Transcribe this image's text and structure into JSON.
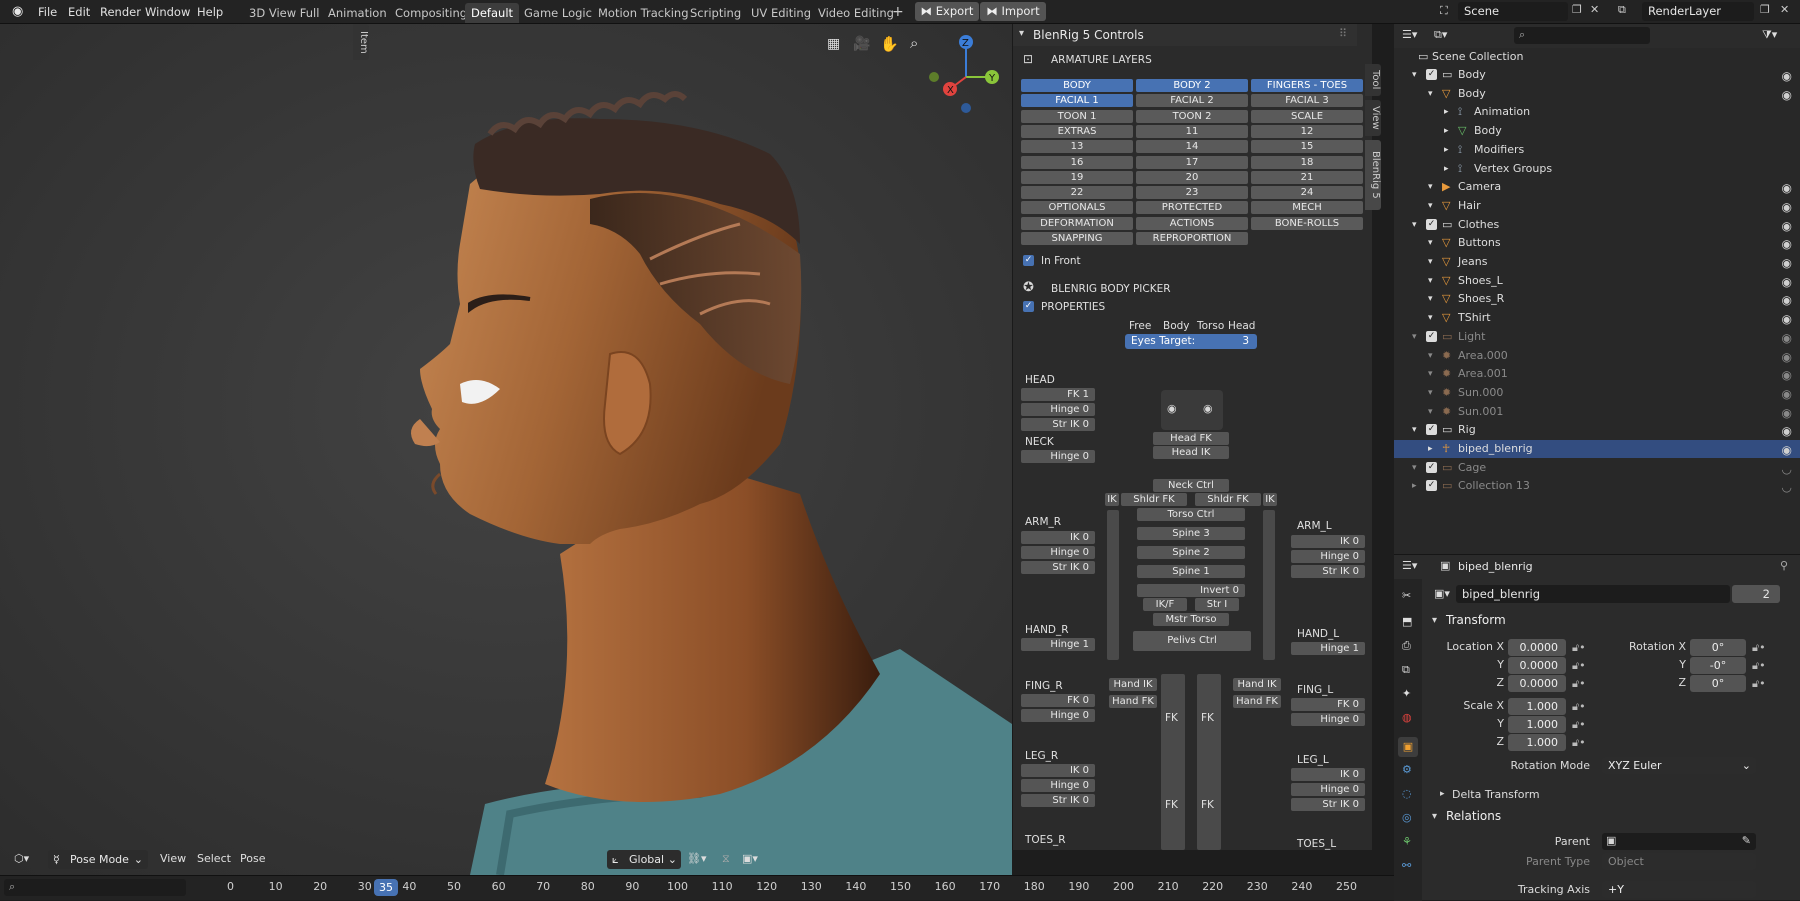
{
  "topbar": {
    "menus": [
      "File",
      "Edit",
      "Render",
      "Window",
      "Help"
    ],
    "workspaces": [
      "3D View Full",
      "Animation",
      "Compositing",
      "Default",
      "Game Logic",
      "Motion Tracking",
      "Scripting",
      "UV Editing",
      "Video Editing"
    ],
    "active_workspace": "Default",
    "export_label": "Export",
    "import_label": "Import",
    "scene_name": "Scene",
    "render_layer": "RenderLayer"
  },
  "viewport": {
    "mode": "Pose Mode",
    "menus": [
      "View",
      "Select",
      "Pose"
    ],
    "orientation": "Global",
    "gizmo": {
      "x": "X",
      "y": "Y",
      "z": "Z"
    }
  },
  "npanel": {
    "title": "BlenRig 5 Controls",
    "tabs": [
      "Item",
      "Tool",
      "View",
      "BlenRig 5"
    ],
    "armature_layers_title": "ARMATURE LAYERS",
    "layers": [
      [
        "BODY",
        "BODY 2",
        "FINGERS - TOES"
      ],
      [
        "FACIAL 1",
        "FACIAL 2",
        "FACIAL 3"
      ],
      [
        "TOON 1",
        "TOON 2",
        "SCALE"
      ],
      [
        "EXTRAS",
        "11",
        "12"
      ],
      [
        "13",
        "14",
        "15"
      ],
      [
        "16",
        "17",
        "18"
      ],
      [
        "19",
        "20",
        "21"
      ],
      [
        "22",
        "23",
        "24"
      ],
      [
        "OPTIONALS",
        "PROTECTED",
        "MECH"
      ],
      [
        "DEFORMATION",
        "ACTIONS",
        "BONE-ROLLS"
      ],
      [
        "SNAPPING",
        "REPROPORTION",
        ""
      ]
    ],
    "in_front": "In Front",
    "body_picker_title": "BLENRIG BODY PICKER",
    "properties": "PROPERTIES",
    "eyes_modes": [
      "Free",
      "Body",
      "Torso",
      "Head"
    ],
    "eyes_target_label": "Eyes Target:",
    "eyes_target_value": "3",
    "head": {
      "label": "HEAD",
      "fk": "FK 1",
      "hinge": "Hinge 0",
      "str_ik": "Str IK 0"
    },
    "neck": {
      "label": "NECK",
      "hinge": "Hinge 0"
    },
    "arm_r": {
      "label": "ARM_R",
      "ik": "IK 0",
      "hinge": "Hinge 0",
      "str_ik": "Str IK 0"
    },
    "arm_l": {
      "label": "ARM_L",
      "ik": "IK 0",
      "hinge": "Hinge 0",
      "str_ik": "Str IK 0"
    },
    "hand_r": {
      "label": "HAND_R",
      "hinge": "Hinge 1"
    },
    "hand_l": {
      "label": "HAND_L",
      "hinge": "Hinge 1"
    },
    "fing_r": {
      "label": "FING_R",
      "fk": "FK 0",
      "hinge": "Hinge 0"
    },
    "fing_l": {
      "label": "FING_L",
      "fk": "FK 0",
      "hinge": "Hinge 0"
    },
    "leg_r": {
      "label": "LEG_R",
      "ik": "IK 0",
      "hinge": "Hinge 0",
      "str_ik": "Str IK 0"
    },
    "leg_l": {
      "label": "LEG_L",
      "ik": "IK 0",
      "hinge": "Hinge 0",
      "str_ik": "Str IK 0"
    },
    "toes_r": {
      "label": "TOES_R"
    },
    "toes_l": {
      "label": "TOES_L"
    },
    "picker": {
      "head_fk": "Head FK",
      "head_ik": "Head IK",
      "neck_ctrl": "Neck Ctrl",
      "shldr_fk_r": "Shldr FK",
      "shldr_fk_l": "Shldr FK",
      "ik": "IK",
      "torso_ctrl": "Torso Ctrl",
      "spine3": "Spine 3",
      "spine2": "Spine 2",
      "spine1": "Spine 1",
      "invert": "Invert 0",
      "ikf": "IK/F",
      "str_i": "Str I",
      "mstr_torso": "Mstr Torso",
      "pelvis_ctrl": "Pelivs Ctrl",
      "hand_ik": "Hand IK",
      "hand_fk": "Hand FK",
      "fk": "FK"
    }
  },
  "outliner": {
    "root": "Scene Collection",
    "rows": [
      {
        "label": "Body",
        "indent": 1,
        "type": "collection"
      },
      {
        "label": "Body",
        "indent": 2,
        "type": "object"
      },
      {
        "label": "Animation",
        "indent": 3,
        "type": "sub"
      },
      {
        "label": "Body",
        "indent": 3,
        "type": "mesh"
      },
      {
        "label": "Modifiers",
        "indent": 3,
        "type": "sub"
      },
      {
        "label": "Vertex Groups",
        "indent": 3,
        "type": "sub"
      },
      {
        "label": "Camera",
        "indent": 2,
        "type": "camera"
      },
      {
        "label": "Hair",
        "indent": 2,
        "type": "object"
      },
      {
        "label": "Clothes",
        "indent": 1,
        "type": "collection"
      },
      {
        "label": "Buttons",
        "indent": 2,
        "type": "object"
      },
      {
        "label": "Jeans",
        "indent": 2,
        "type": "object"
      },
      {
        "label": "Shoes_L",
        "indent": 2,
        "type": "object"
      },
      {
        "label": "Shoes_R",
        "indent": 2,
        "type": "object"
      },
      {
        "label": "TShirt",
        "indent": 2,
        "type": "object"
      },
      {
        "label": "Light",
        "indent": 1,
        "type": "collection",
        "dim": true
      },
      {
        "label": "Area.000",
        "indent": 2,
        "type": "light",
        "dim": true
      },
      {
        "label": "Area.001",
        "indent": 2,
        "type": "light",
        "dim": true
      },
      {
        "label": "Sun.000",
        "indent": 2,
        "type": "light",
        "dim": true
      },
      {
        "label": "Sun.001",
        "indent": 2,
        "type": "light",
        "dim": true
      },
      {
        "label": "Rig",
        "indent": 1,
        "type": "collection"
      },
      {
        "label": "biped_blenrig",
        "indent": 2,
        "type": "armature",
        "selected": true
      },
      {
        "label": "Cage",
        "indent": 1,
        "type": "collection",
        "dim": true
      },
      {
        "label": "Collection 13",
        "indent": 1,
        "type": "collection",
        "dim": true
      }
    ]
  },
  "properties": {
    "object_name": "biped_blenrig",
    "data_name": "biped_blenrig",
    "users": "2",
    "transform_title": "Transform",
    "location_label": "Location X",
    "loc": [
      "0.0000",
      "0.0000",
      "0.0000"
    ],
    "rotation_label": "Rotation X",
    "rot": [
      "0°",
      "-0°",
      "0°"
    ],
    "scale_label": "Scale X",
    "scale": [
      "1.000",
      "1.000",
      "1.000"
    ],
    "axis_y": "Y",
    "axis_z": "Z",
    "rotation_mode_label": "Rotation Mode",
    "rotation_mode": "XYZ Euler",
    "delta_transform": "Delta Transform",
    "relations_title": "Relations",
    "parent_label": "Parent",
    "parent_type_label": "Parent Type",
    "parent_type": "Object",
    "tracking_axis_label": "Tracking Axis",
    "tracking_axis": "+Y"
  },
  "timeline": {
    "current_frame": "35",
    "ticks": [
      "0",
      "10",
      "20",
      "30",
      "40",
      "50",
      "60",
      "70",
      "80",
      "90",
      "100",
      "110",
      "120",
      "130",
      "140",
      "150",
      "160",
      "170",
      "180",
      "190",
      "200",
      "210",
      "220",
      "230",
      "240",
      "250"
    ]
  },
  "colors": {
    "accent": "#4772b3",
    "selection": "#334d80",
    "button": "#5a5a5a",
    "panel_bg": "#2b2b2b"
  }
}
